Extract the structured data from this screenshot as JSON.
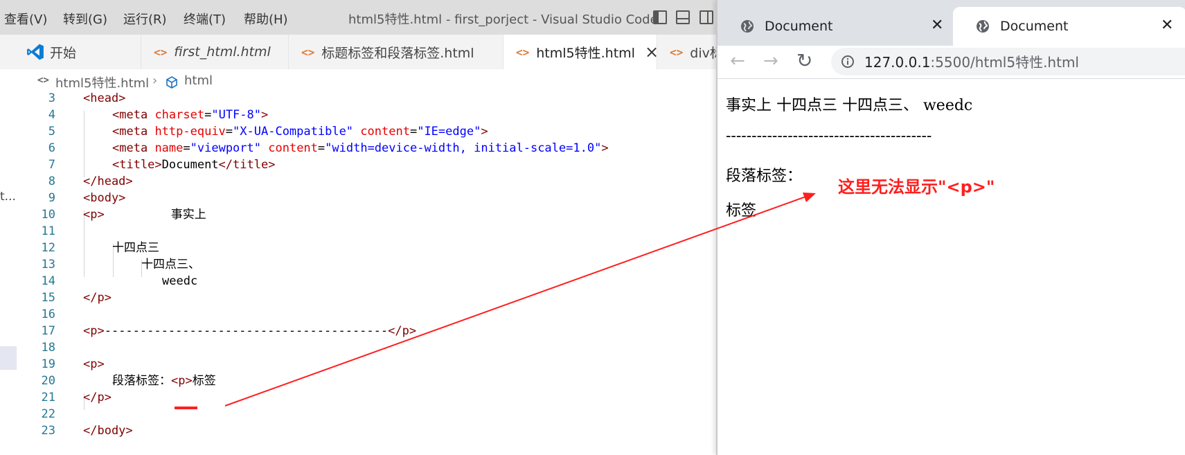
{
  "vscode": {
    "menu": [
      "查看(V)",
      "转到(G)",
      "运行(R)",
      "终端(T)",
      "帮助(H)"
    ],
    "window_title": "html5特性.html - first_porject - Visual Studio Code",
    "tabs": [
      {
        "label": "开始",
        "icon": "vscode-logo-icon"
      },
      {
        "label": "first_html.html",
        "icon": "html-file-icon"
      },
      {
        "label": "标题标签和段落标签.html",
        "icon": "html-file-icon"
      },
      {
        "label": "html5特性.html",
        "icon": "html-file-icon",
        "active": true
      },
      {
        "label": "div标",
        "icon": "html-file-icon"
      }
    ],
    "breadcrumb": {
      "file": "html5特性.html",
      "symbol": "html"
    },
    "sidebar_overflow": "t...",
    "line_numbers": [
      "3",
      "4",
      "5",
      "6",
      "7",
      "8",
      "9",
      "10",
      "11",
      "12",
      "13",
      "14",
      "15",
      "16",
      "17",
      "18",
      "19",
      "20",
      "21",
      "22",
      "23"
    ],
    "code": {
      "l3": "<head>",
      "l4_tag": "<meta",
      "l4_attr": "charset",
      "l4_val": "\"UTF-8\"",
      "l4_end": ">",
      "l5_tag": "<meta",
      "l5_attr1": "http-equiv",
      "l5_val1": "\"X-UA-Compatible\"",
      "l5_attr2": "content",
      "l5_val2": "\"IE=edge\"",
      "l5_end": ">",
      "l6_tag": "<meta",
      "l6_attr1": "name",
      "l6_val1": "\"viewport\"",
      "l6_attr2": "content",
      "l6_val2": "\"width=device-width, initial-scale=1.0\"",
      "l6_end": ">",
      "l7_open": "<title>",
      "l7_text": "Document",
      "l7_close": "</title>",
      "l8": "</head>",
      "l9": "<body>",
      "l10_tag": "<p>",
      "l10_text": "事实上",
      "l12_text": "十四点三",
      "l13_text": "十四点三、",
      "l14_text": "weedc",
      "l15": "</p>",
      "l17_open": "<p>",
      "l17_dashes": "----------------------------------------",
      "l17_close": "</p>",
      "l19": "<p>",
      "l20_text1": "段落标签：",
      "l20_code": "<p>",
      "l20_text2": "标签",
      "l21": "</p>",
      "l23": "</body>"
    }
  },
  "browser": {
    "tabs": [
      {
        "label": "Document",
        "icon": "globe-icon"
      },
      {
        "label": "Document",
        "icon": "globe-icon",
        "active": true
      }
    ],
    "url_host": "127.0.0.1",
    "url_path": ":5500/html5特性.html",
    "page": {
      "line1": "事实上 十四点三 十四点三、 weedc",
      "line2": "----------------------------------------",
      "line3": "段落标签：",
      "line4": "标签"
    },
    "annotation": "这里无法显示\"<p>\""
  },
  "colors": {
    "annotation": "#ff1e1e",
    "tag": "#800000",
    "attr": "#e50000",
    "value": "#0000ff"
  }
}
